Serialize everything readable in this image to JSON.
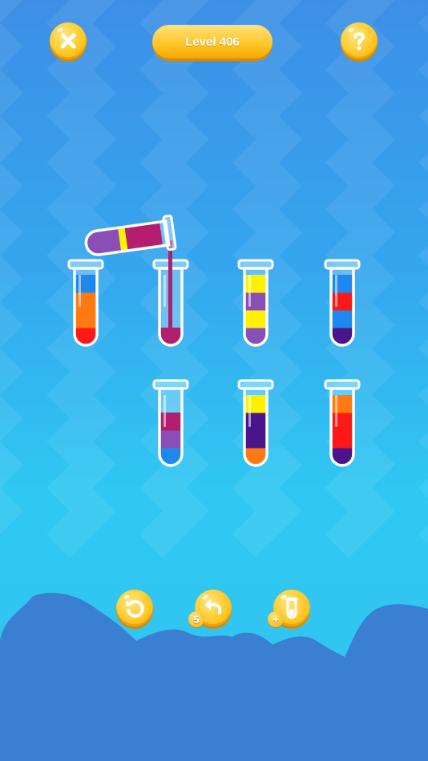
{
  "header": {
    "level_label": "Level 406"
  },
  "bottom_bar": {
    "undo_count": "5",
    "add_tube_symbol": "+"
  },
  "colors": {
    "blue": "#1e88ee",
    "orange": "#ff7a10",
    "red": "#ff1818",
    "magenta": "#b41e6e",
    "yellow": "#fff200",
    "purple": "#8a4fb6",
    "indigo": "#4a158a",
    "accent_gold": "#ffc426",
    "background_top": "#3d8fe6",
    "background_bottom": "#2fc4f0",
    "ground": "#3a7fd0"
  },
  "tubes": [
    {
      "name": "tube-1",
      "layers_bottom_to_top": [
        "red",
        "orange",
        "orange",
        "blue"
      ]
    },
    {
      "name": "tube-2",
      "layers_bottom_to_top": [
        "magenta"
      ],
      "receiving_pour": true
    },
    {
      "name": "tube-3",
      "layers_bottom_to_top": [
        "purple",
        "yellow",
        "purple",
        "yellow"
      ]
    },
    {
      "name": "tube-4",
      "layers_bottom_to_top": [
        "indigo",
        "blue",
        "red",
        "blue"
      ]
    },
    {
      "name": "tube-5",
      "layers_bottom_to_top": [
        "blue",
        "purple",
        "magenta"
      ]
    },
    {
      "name": "tube-6",
      "layers_bottom_to_top": [
        "orange",
        "indigo",
        "indigo",
        "yellow"
      ]
    },
    {
      "name": "tube-7",
      "layers_bottom_to_top": [
        "indigo",
        "red",
        "red",
        "orange"
      ]
    }
  ],
  "pouring_tube": {
    "name": "pouring-tube",
    "layers_bottom_to_top": [
      "magenta",
      "magenta",
      "yellow",
      "purple"
    ]
  }
}
